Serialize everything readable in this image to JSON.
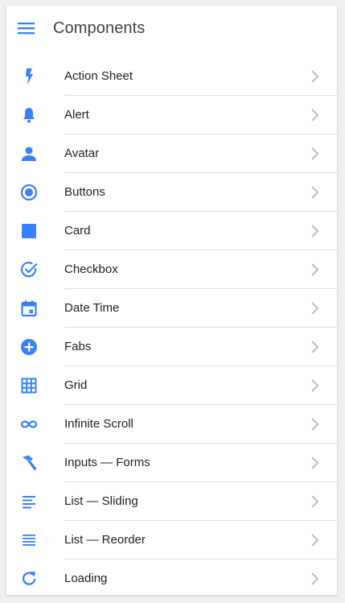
{
  "header": {
    "title": "Components",
    "menu_icon": "hamburger-menu-icon"
  },
  "colors": {
    "accent": "#3880ff",
    "text": "#212121",
    "chevron": "#bdbdbd",
    "divider": "#dedede"
  },
  "items": [
    {
      "label": "Action Sheet",
      "icon": "flash-icon"
    },
    {
      "label": "Alert",
      "icon": "bell-icon"
    },
    {
      "label": "Avatar",
      "icon": "person-icon"
    },
    {
      "label": "Buttons",
      "icon": "radio-button-icon"
    },
    {
      "label": "Card",
      "icon": "square-icon"
    },
    {
      "label": "Checkbox",
      "icon": "checkmark-circle-icon"
    },
    {
      "label": "Date Time",
      "icon": "calendar-icon"
    },
    {
      "label": "Fabs",
      "icon": "add-circle-icon"
    },
    {
      "label": "Grid",
      "icon": "grid-icon"
    },
    {
      "label": "Infinite Scroll",
      "icon": "infinite-icon"
    },
    {
      "label": "Inputs — Forms",
      "icon": "hammer-icon"
    },
    {
      "label": "List — Sliding",
      "icon": "list-lines-icon"
    },
    {
      "label": "List — Reorder",
      "icon": "reorder-icon"
    },
    {
      "label": "Loading",
      "icon": "refresh-icon"
    }
  ]
}
